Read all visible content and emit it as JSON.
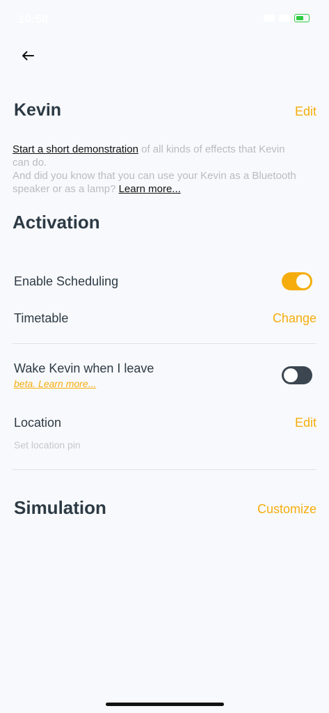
{
  "status_bar": {
    "time": "10:58"
  },
  "header": {
    "device_name": "Kevin",
    "edit_label": "Edit"
  },
  "intro": {
    "demo_link": "Start a short demonstration",
    "text_1": " of all kinds of effects that Kevin can do.",
    "text_2": "And did you know that you can use your Kevin as a Bluetooth speaker or as a lamp? ",
    "learn_more": "Learn more..."
  },
  "activation": {
    "title": "Activation",
    "enable_scheduling": {
      "label": "Enable Scheduling",
      "on": true
    },
    "timetable": {
      "label": "Timetable",
      "action": "Change"
    },
    "wake": {
      "label": "Wake Kevin when I leave",
      "sub_link": "beta. Learn more...",
      "on": false
    },
    "location": {
      "label": "Location",
      "action": "Edit",
      "hint": "Set location pin"
    }
  },
  "simulation": {
    "title": "Simulation",
    "action": "Customize"
  },
  "colors": {
    "accent": "#f5ad0d",
    "text": "#2c3a44",
    "muted": "#b7bcc2",
    "toggle_off": "#3b4650",
    "background": "#f8f9fc"
  }
}
